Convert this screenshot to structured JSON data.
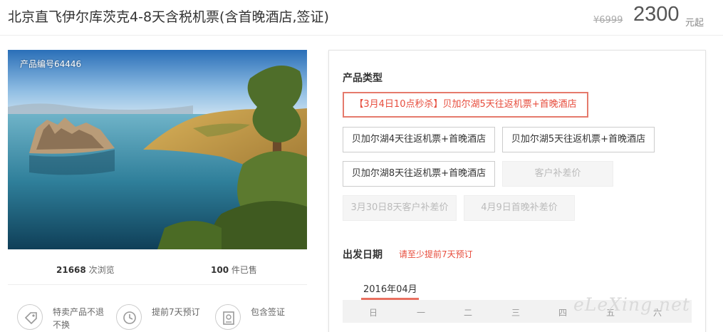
{
  "header": {
    "title": "北京直飞伊尔库茨克4-8天含税机票(含首晚酒店,签证)",
    "original_price": "¥6999",
    "price": "2300",
    "price_unit": "元起"
  },
  "gallery": {
    "product_id": "产品编号64446"
  },
  "stats": {
    "views_count": "21668",
    "views_label": "次浏览",
    "sold_count": "100",
    "sold_label": "件已售"
  },
  "features": [
    {
      "icon": "tag-icon",
      "label": "特卖产品不退不换"
    },
    {
      "icon": "clock-icon",
      "label": "提前7天预订"
    },
    {
      "icon": "visa-icon",
      "label": "包含签证"
    }
  ],
  "booking": {
    "product_type_title": "产品类型",
    "options": [
      {
        "label": "【3月4日10点秒杀】贝加尔湖5天往返机票+首晚酒店",
        "state": "selected"
      },
      {
        "label": "贝加尔湖4天往返机票+首晚酒店",
        "state": "normal"
      },
      {
        "label": "贝加尔湖5天往返机票+首晚酒店",
        "state": "normal"
      },
      {
        "label": "贝加尔湖8天往返机票+首晚酒店",
        "state": "normal"
      },
      {
        "label": "客户补差价",
        "state": "disabled"
      },
      {
        "label": "3月30日8天客户补差价",
        "state": "disabled"
      },
      {
        "label": "4月9日首晚补差价",
        "state": "disabled"
      }
    ],
    "departure_title": "出发日期",
    "departure_hint": "请至少提前7天预订",
    "calendar": {
      "month": "2016年04月",
      "weekdays": [
        "日",
        "一",
        "二",
        "三",
        "四",
        "五",
        "六"
      ]
    }
  },
  "watermark": "eLeXing.net",
  "colors": {
    "accent": "#e74c3c",
    "selected_border": "#e57a6c",
    "disabled_bg": "#f5f5f5"
  }
}
